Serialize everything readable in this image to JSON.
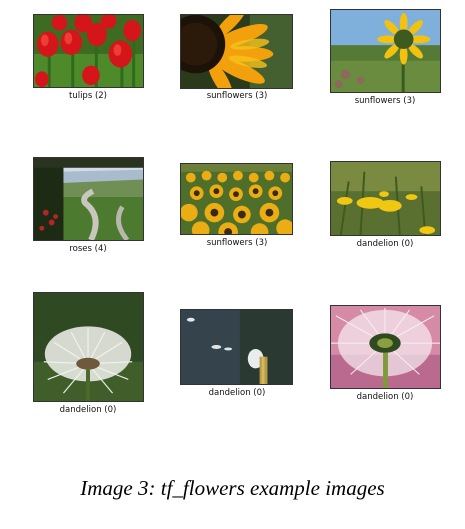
{
  "figure": {
    "caption": "Image 3: tf_flowers example images",
    "images": [
      {
        "label": "tulips (2)",
        "subject": "red tulips"
      },
      {
        "label": "sunflowers (3)",
        "subject": "sunflower closeup"
      },
      {
        "label": "sunflowers (3)",
        "subject": "sunflower under blue sky"
      },
      {
        "label": "roses (4)",
        "subject": "valley with winding path"
      },
      {
        "label": "sunflowers (3)",
        "subject": "sunflower field"
      },
      {
        "label": "dandelion (0)",
        "subject": "yellow dandelions in grass"
      },
      {
        "label": "dandelion (0)",
        "subject": "dandelion seed head"
      },
      {
        "label": "dandelion (0)",
        "subject": "dandelion seeds blowing"
      },
      {
        "label": "dandelion (0)",
        "subject": "dandelion clock on pink background"
      }
    ]
  }
}
